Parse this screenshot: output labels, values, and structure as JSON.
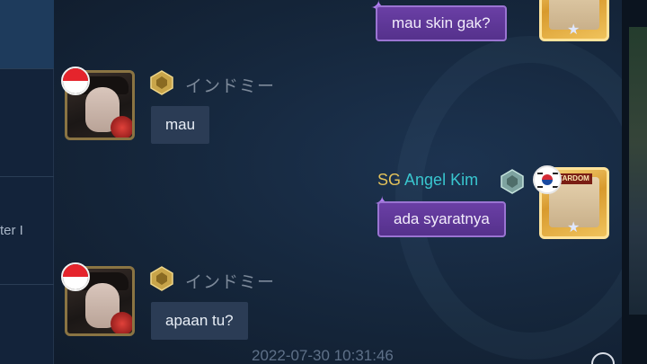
{
  "sidebar": {
    "fragment_text": "ter I"
  },
  "messages": [
    {
      "side": "right",
      "text": "mau skin gak?"
    },
    {
      "side": "left",
      "sender_name": "インドミー",
      "flag": "indonesia-flag-icon",
      "text": "mau"
    },
    {
      "side": "right",
      "sender_tag": "SG",
      "sender_name": "Angel Kim",
      "flag": "korea-flag-icon",
      "frame_badge": "STARDOM",
      "text": "ada syaratnya"
    },
    {
      "side": "left",
      "sender_name": "インドミー",
      "flag": "indonesia-flag-icon",
      "text": "apaan tu?"
    }
  ],
  "timestamp": "2022-07-30 10:31:46",
  "colors": {
    "right_bubble": "#5e3799",
    "left_bubble": "#2b3c55",
    "guild_tag": "#e2c15a",
    "sender_name": "#39c6cf"
  }
}
